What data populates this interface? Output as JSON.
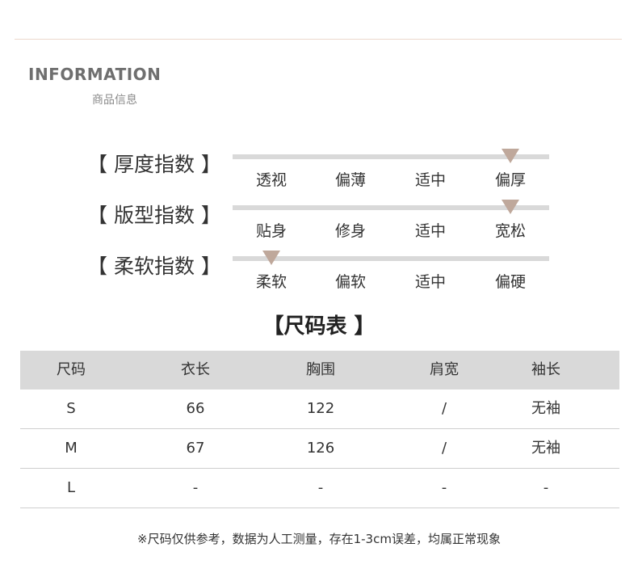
{
  "info": {
    "title": "INFORMATION",
    "subtitle": "商品信息"
  },
  "indices": [
    {
      "label": "【 厚度指数 】",
      "options": [
        "透视",
        "偏薄",
        "适中",
        "偏厚"
      ],
      "selected": 3
    },
    {
      "label": "【 版型指数 】",
      "options": [
        "贴身",
        "修身",
        "适中",
        "宽松"
      ],
      "selected": 3
    },
    {
      "label": "【 柔软指数 】",
      "options": [
        "柔软",
        "偏软",
        "适中",
        "偏硬"
      ],
      "selected": 0
    }
  ],
  "size_table": {
    "title": "【尺码表 】",
    "headers": [
      "尺码",
      "衣长",
      "胸围",
      "肩宽",
      "袖长"
    ],
    "rows": [
      [
        "S",
        "66",
        "122",
        "/",
        "无袖"
      ],
      [
        "M",
        "67",
        "126",
        "/",
        "无袖"
      ],
      [
        "L",
        "-",
        "-",
        "-",
        "-"
      ]
    ]
  },
  "note": "※尺码仅供参考，数据为人工测量，存在1-3cm误差，均属正常现象",
  "colors": {
    "marker": "#bfa89b",
    "track": "#d9d9d9",
    "header_bg": "#d9d9d9",
    "top_line": "#ecd8cc"
  }
}
